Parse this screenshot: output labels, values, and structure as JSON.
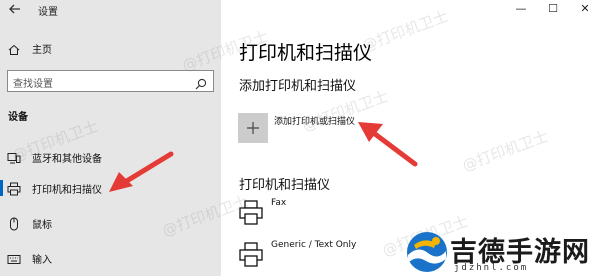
{
  "window": {
    "title": "设置",
    "back_icon": "back-arrow-icon",
    "controls": {
      "minimize": "—",
      "maximize": "☐",
      "close": "✕"
    }
  },
  "sidebar": {
    "home_label": "主页",
    "search_placeholder": "查找设置",
    "group_title": "设备",
    "items": [
      {
        "label": "蓝牙和其他设备",
        "icon": "devices-icon"
      },
      {
        "label": "打印机和扫描仪",
        "icon": "printer-icon",
        "active": true
      },
      {
        "label": "鼠标",
        "icon": "mouse-icon"
      },
      {
        "label": "输入",
        "icon": "keyboard-icon"
      }
    ]
  },
  "main": {
    "page_title": "打印机和扫描仪",
    "add_section_title": "添加打印机和扫描仪",
    "add_button_label": "添加打印机或扫描仪",
    "list_section_title": "打印机和扫描仪",
    "printers": [
      {
        "name": "Fax"
      },
      {
        "name": "Generic / Text Only"
      }
    ]
  },
  "watermark_text": "@打印机卫士",
  "brand": {
    "name": "吉德手游网",
    "domain": "jdzhnl.com",
    "colors": {
      "accent": "#0067c0",
      "arrow": "#e43b36",
      "logo_blue": "#1a73c9",
      "logo_yellow": "#f4b400"
    }
  }
}
